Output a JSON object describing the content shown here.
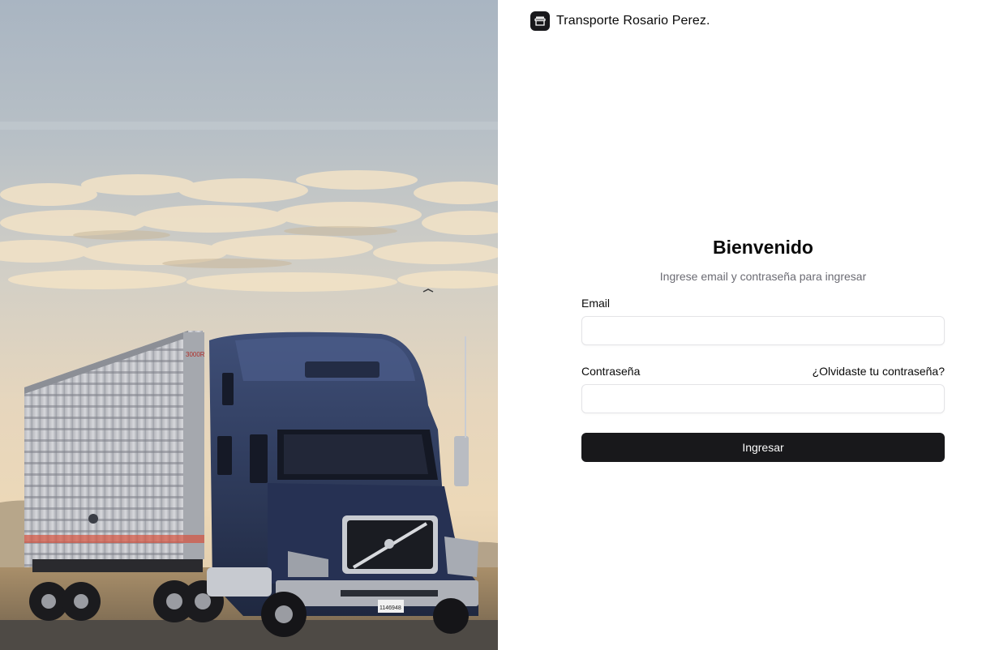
{
  "brand": {
    "name": "Transporte Rosario Perez.",
    "icon": "package-icon"
  },
  "hero_image": {
    "subject": "truck-photo",
    "trailer_text": "3000R",
    "plate_text": "1146948"
  },
  "login": {
    "title": "Bienvenido",
    "subtitle": "Ingrese email y contraseña para ingresar",
    "email_label": "Email",
    "email_value": "",
    "password_label": "Contraseña",
    "password_value": "",
    "forgot_link": "¿Olvidaste tu contraseña?",
    "submit_label": "Ingresar"
  },
  "colors": {
    "primary": "#18181b",
    "muted_text": "#6b6b73",
    "input_border": "#e4e4e7"
  }
}
